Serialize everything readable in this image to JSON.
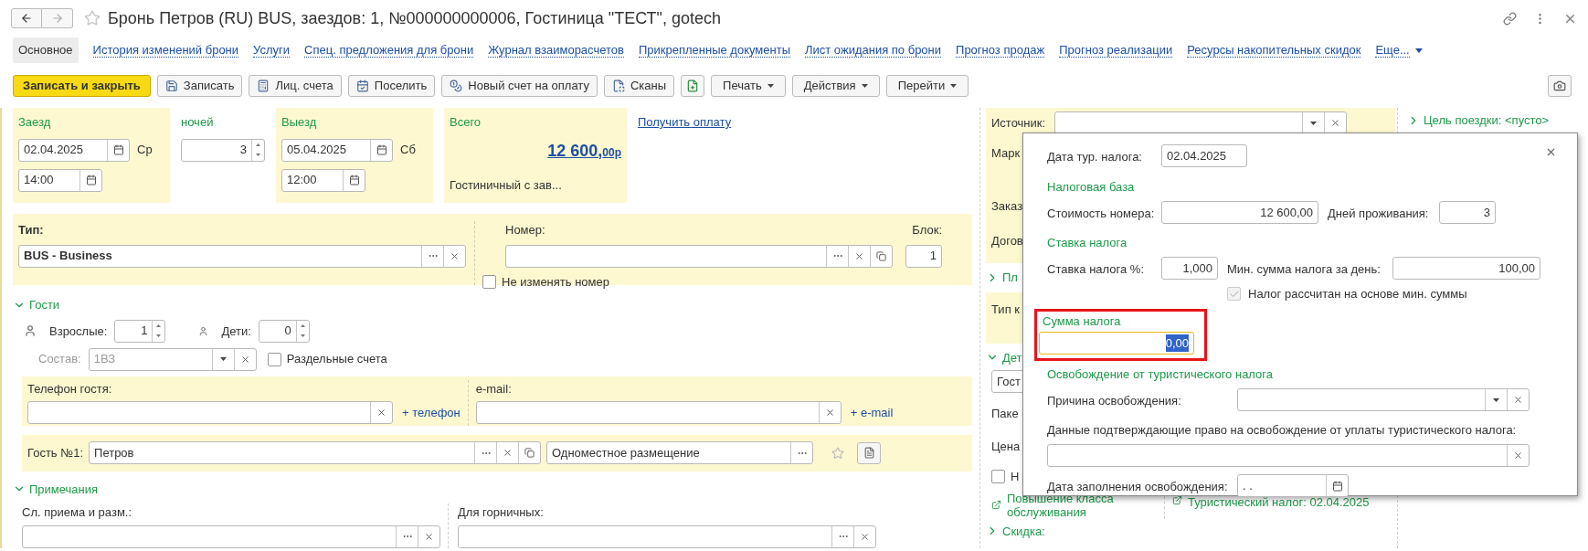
{
  "window": {
    "title": "Бронь Петров (RU) BUS, заездов: 1, №000000000006, Гостиница \"ТЕСТ\", gotech"
  },
  "tabs": [
    {
      "label": "Основное",
      "selected": true
    },
    {
      "label": "История изменений брони",
      "selected": false
    },
    {
      "label": "Услуги",
      "selected": false
    },
    {
      "label": "Спец. предложения для брони",
      "selected": false
    },
    {
      "label": "Журнал взаиморасчетов",
      "selected": false
    },
    {
      "label": "Прикрепленные документы",
      "selected": false
    },
    {
      "label": "Лист ожидания по брони",
      "selected": false
    },
    {
      "label": "Прогноз продаж",
      "selected": false
    },
    {
      "label": "Прогноз реализации",
      "selected": false
    },
    {
      "label": "Ресурсы накопительных скидок",
      "selected": false
    }
  ],
  "more_tabs": "Еще...",
  "toolbar": [
    {
      "kind": "primary",
      "label": "Записать и закрыть"
    },
    {
      "kind": "icon",
      "label": "Записать"
    },
    {
      "kind": "icon",
      "label": "Лиц. счета"
    },
    {
      "kind": "icon",
      "label": "Поселить"
    },
    {
      "kind": "icon",
      "label": "Новый счет на оплату"
    },
    {
      "kind": "icon",
      "label": "Сканы"
    },
    {
      "kind": "icon-only"
    },
    {
      "kind": "menu",
      "label": "Печать"
    },
    {
      "kind": "menu",
      "label": "Действия"
    },
    {
      "kind": "menu",
      "label": "Перейти"
    }
  ],
  "checkin": {
    "label": "Заезд",
    "date": "02.04.2025",
    "weekday": "Ср",
    "time": "14:00"
  },
  "nights": {
    "label": "ночей",
    "value": "3"
  },
  "checkout": {
    "label": "Выезд",
    "date": "05.04.2025",
    "weekday": "Сб",
    "time": "12:00"
  },
  "total": {
    "label": "Всего",
    "amount": "12 600,",
    "cents": "00р",
    "tariff": "Гостиничный с зав..."
  },
  "pay_link": "Получить оплату",
  "room_type": {
    "label": "Тип:",
    "value": "BUS - Business"
  },
  "room": {
    "label": "Номер:"
  },
  "block": {
    "label": "Блок:",
    "value": "1"
  },
  "keep_room": {
    "label": "Не изменять номер",
    "checked": false
  },
  "guests": {
    "title": "Гости",
    "expanded": true,
    "adults_label": "Взрослые:",
    "adults": "1",
    "children_label": "Дети:",
    "children": "0",
    "composition_label": "Состав:",
    "composition": "1ВЗ",
    "composition_disabled": true,
    "separate": {
      "label": "Раздельные счета",
      "checked": false
    },
    "phone_label": "Телефон гостя:",
    "add_phone": "+ телефон",
    "email_label": "e-mail:",
    "add_email": "+ e-mail",
    "guest_label": "Гость №1:",
    "guest": "Петров",
    "accommodation": "Одноместное размещение"
  },
  "notes": {
    "title": "Примечания",
    "expanded": true,
    "reception_label": "Сл. приема и разм.:",
    "maid_label": "Для горничных:"
  },
  "right_panel": {
    "source_label": "Источник:",
    "labels": [
      "Марк",
      "Заказ",
      "Догов"
    ],
    "plan": {
      "title": "Пл",
      "expanded": false
    },
    "client_type": "Тип к",
    "details": {
      "title": "Дет",
      "expanded": true
    },
    "guest_field": "Гост",
    "package": "Паке",
    "price": "Цена",
    "option": {
      "label": "Н",
      "checked": false
    },
    "upgrade": "Повышение класса обслуживания",
    "tourist_tax": "Туристический налог: 02.04.2025",
    "discount": {
      "title": "Скидка:",
      "expanded": false
    }
  },
  "trip_purpose": {
    "title": "Цель поездки: <пусто>",
    "expanded": false
  },
  "popup": {
    "tax_date_label": "Дата тур. налога:",
    "tax_date": "02.04.2025",
    "base_title": "Налоговая база",
    "room_cost_label": "Стоимость номера:",
    "room_cost": "12 600,00",
    "days_label": "Дней проживания:",
    "days": "3",
    "rate_title": "Ставка налога",
    "rate_label": "Ставка налога %:",
    "rate": "1,000",
    "min_label": "Мин. сумма налога за день:",
    "min": "100,00",
    "min_based": {
      "label": "Налог рассчитан на основе мин. суммы",
      "checked": true
    },
    "sum_title": "Сумма налога",
    "sum": "0,00",
    "sum_highlighted": true,
    "exemption_title": "Освобождение от туристического налога",
    "reason_label": "Причина освобождения:",
    "proof_label": "Данные подтверждающие право на освобождение от уплаты туристического налога:",
    "fill_date_label": "Дата заполнения освобождения:",
    "fill_date": ". ."
  }
}
